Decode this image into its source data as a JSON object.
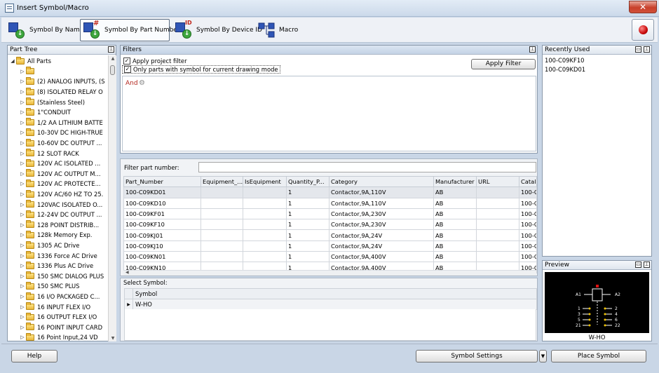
{
  "window": {
    "title": "Insert Symbol/Macro",
    "close_glyph": "✕"
  },
  "toolbar": {
    "buttons": [
      {
        "label": "Symbol By Name",
        "icon": "symbol-by-name-icon",
        "tag": ""
      },
      {
        "label": "Symbol By Part Number",
        "icon": "symbol-by-part-number-icon",
        "tag": "#"
      },
      {
        "label": "Symbol By Device ID",
        "icon": "symbol-by-device-id-icon",
        "tag": "ID"
      },
      {
        "label": "Macro",
        "icon": "macro-icon",
        "tag": ""
      }
    ],
    "active_index": 1
  },
  "part_tree": {
    "title": "Part Tree",
    "items": [
      {
        "label": "All Parts",
        "expanded": true
      },
      {
        "label": ""
      },
      {
        "label": "(2) ANALOG INPUTS, (S"
      },
      {
        "label": "(8) ISOLATED RELAY O"
      },
      {
        "label": "(Stainless Steel)"
      },
      {
        "label": "1\"CONDUIT"
      },
      {
        "label": "1/2 AA LITHIUM BATTE"
      },
      {
        "label": "10-30V DC HIGH-TRUE"
      },
      {
        "label": "10-60V DC OUTPUT ..."
      },
      {
        "label": "12 SLOT RACK"
      },
      {
        "label": "120V AC ISOLATED ..."
      },
      {
        "label": "120V AC OUTPUT M..."
      },
      {
        "label": "120V AC PROTECTE..."
      },
      {
        "label": "120V AC/60 HZ TO 25."
      },
      {
        "label": "120VAC ISOLATED O..."
      },
      {
        "label": "12-24V DC OUTPUT ..."
      },
      {
        "label": "128 POINT DISTRIB..."
      },
      {
        "label": "128k Memory Exp."
      },
      {
        "label": "1305 AC Drive"
      },
      {
        "label": "1336 Force AC Drive"
      },
      {
        "label": "1336 Plus AC Drive"
      },
      {
        "label": "150 SMC DIALOG PLUS"
      },
      {
        "label": "150 SMC PLUS"
      },
      {
        "label": "16 I/O PACKAGED C..."
      },
      {
        "label": "16 INPUT FLEX I/O"
      },
      {
        "label": "16 OUTPUT FLEX I/O"
      },
      {
        "label": "16 POINT INPUT CARD"
      },
      {
        "label": "16 Point Input,24 VD"
      }
    ]
  },
  "filters": {
    "title": "Filters",
    "apply_project_filter": {
      "label": "Apply project filter",
      "checked": true
    },
    "only_parts_with_symbol": {
      "label": "Only parts with symbol for current drawing mode",
      "checked": true
    },
    "apply_button": "Apply Filter",
    "and_label": "And"
  },
  "grid": {
    "filter_label": "Filter part number:",
    "filter_value": "",
    "columns": [
      "Part_Number",
      "Equipment_...",
      "IsEquipment",
      "Quantity_P...",
      "Category",
      "Manufacturer",
      "URL",
      "Catalo"
    ],
    "rows": [
      [
        "100-C09KD01",
        "",
        "",
        "1",
        "Contactor,9A,110V",
        "AB",
        "",
        "100-C"
      ],
      [
        "100-C09KD10",
        "",
        "",
        "1",
        "Contactor,9A,110V",
        "AB",
        "",
        "100-C"
      ],
      [
        "100-C09KF01",
        "",
        "",
        "1",
        "Contactor,9A,230V",
        "AB",
        "",
        "100-C"
      ],
      [
        "100-C09KF10",
        "",
        "",
        "1",
        "Contactor,9A,230V",
        "AB",
        "",
        "100-C"
      ],
      [
        "100-C09KJ01",
        "",
        "",
        "1",
        "Contactor,9A,24V",
        "AB",
        "",
        "100-C"
      ],
      [
        "100-C09KJ10",
        "",
        "",
        "1",
        "Contactor,9A,24V",
        "AB",
        "",
        "100-C"
      ],
      [
        "100-C09KN01",
        "",
        "",
        "1",
        "Contactor,9A,400V",
        "AB",
        "",
        "100-C"
      ],
      [
        "100-C09KN10",
        "",
        "",
        "1",
        "Contactor,9A,400V",
        "AB",
        "",
        "100-C"
      ]
    ]
  },
  "select_symbol": {
    "title": "Select Symbol:",
    "column": "Symbol",
    "rows": [
      "W-HO"
    ]
  },
  "recently_used": {
    "title": "Recently Used",
    "items": [
      "100-C09KF10",
      "100-C09KD01"
    ]
  },
  "preview": {
    "title": "Preview",
    "caption": "W-HO",
    "terminals_left": [
      "A1",
      "1",
      "3",
      "5",
      "21"
    ],
    "terminals_right": [
      "A2",
      "2",
      "4",
      "6",
      "22"
    ]
  },
  "footer": {
    "help": "Help",
    "symbol_settings": "Symbol Settings",
    "place_symbol": "Place Symbol"
  }
}
